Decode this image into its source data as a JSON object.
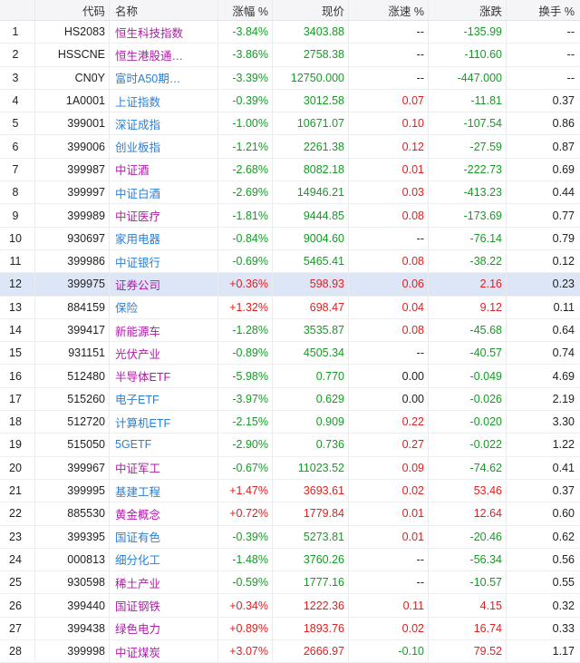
{
  "colors": {
    "up": "#e02020",
    "down": "#169b26",
    "name_blue": "#2a7fd4",
    "name_purple": "#b01aa8",
    "selected_row": "#dde6f7"
  },
  "headers": {
    "code": "代码",
    "name": "名称",
    "change_pct": "涨幅 %",
    "price": "现价",
    "speed": "涨速 %",
    "change": "涨跌",
    "turnover": "换手 %"
  },
  "rows": [
    {
      "idx": "1",
      "code": "HS2083",
      "name": "恒生科技指数",
      "name_color": "purple",
      "chg": "-3.84%",
      "chg_dir": "down",
      "price": "3403.88",
      "price_dir": "down",
      "speed": "--",
      "speed_dir": "none",
      "diff": "-135.99",
      "diff_dir": "down",
      "turnover": "--"
    },
    {
      "idx": "2",
      "code": "HSSCNE",
      "name": "恒生港股通…",
      "name_color": "purple",
      "chg": "-3.86%",
      "chg_dir": "down",
      "price": "2758.38",
      "price_dir": "down",
      "speed": "--",
      "speed_dir": "none",
      "diff": "-110.60",
      "diff_dir": "down",
      "turnover": "--"
    },
    {
      "idx": "3",
      "code": "CN0Y",
      "name": "富时A50期…",
      "name_color": "blue",
      "chg": "-3.39%",
      "chg_dir": "down",
      "price": "12750.000",
      "price_dir": "down",
      "speed": "--",
      "speed_dir": "none",
      "diff": "-447.000",
      "diff_dir": "down",
      "turnover": "--"
    },
    {
      "idx": "4",
      "code": "1A0001",
      "name": "上证指数",
      "name_color": "blue",
      "chg": "-0.39%",
      "chg_dir": "down",
      "price": "3012.58",
      "price_dir": "down",
      "speed": "0.07",
      "speed_dir": "up",
      "diff": "-11.81",
      "diff_dir": "down",
      "turnover": "0.37"
    },
    {
      "idx": "5",
      "code": "399001",
      "name": "深证成指",
      "name_color": "blue",
      "chg": "-1.00%",
      "chg_dir": "down",
      "price": "10671.07",
      "price_dir": "down",
      "speed": "0.10",
      "speed_dir": "up",
      "diff": "-107.54",
      "diff_dir": "down",
      "turnover": "0.86"
    },
    {
      "idx": "6",
      "code": "399006",
      "name": "创业板指",
      "name_color": "blue",
      "chg": "-1.21%",
      "chg_dir": "down",
      "price": "2261.38",
      "price_dir": "down",
      "speed": "0.12",
      "speed_dir": "up",
      "diff": "-27.59",
      "diff_dir": "down",
      "turnover": "0.87"
    },
    {
      "idx": "7",
      "code": "399987",
      "name": "中证酒",
      "name_color": "purple",
      "chg": "-2.68%",
      "chg_dir": "down",
      "price": "8082.18",
      "price_dir": "down",
      "speed": "0.01",
      "speed_dir": "up",
      "diff": "-222.73",
      "diff_dir": "down",
      "turnover": "0.69"
    },
    {
      "idx": "8",
      "code": "399997",
      "name": "中证白酒",
      "name_color": "blue",
      "chg": "-2.69%",
      "chg_dir": "down",
      "price": "14946.21",
      "price_dir": "down",
      "speed": "0.03",
      "speed_dir": "up",
      "diff": "-413.23",
      "diff_dir": "down",
      "turnover": "0.44"
    },
    {
      "idx": "9",
      "code": "399989",
      "name": "中证医疗",
      "name_color": "purple",
      "chg": "-1.81%",
      "chg_dir": "down",
      "price": "9444.85",
      "price_dir": "down",
      "speed": "0.08",
      "speed_dir": "up",
      "diff": "-173.69",
      "diff_dir": "down",
      "turnover": "0.77"
    },
    {
      "idx": "10",
      "code": "930697",
      "name": "家用电器",
      "name_color": "blue",
      "chg": "-0.84%",
      "chg_dir": "down",
      "price": "9004.60",
      "price_dir": "down",
      "speed": "--",
      "speed_dir": "none",
      "diff": "-76.14",
      "diff_dir": "down",
      "turnover": "0.79"
    },
    {
      "idx": "11",
      "code": "399986",
      "name": "中证银行",
      "name_color": "blue",
      "chg": "-0.69%",
      "chg_dir": "down",
      "price": "5465.41",
      "price_dir": "down",
      "speed": "0.08",
      "speed_dir": "up",
      "diff": "-38.22",
      "diff_dir": "down",
      "turnover": "0.12"
    },
    {
      "idx": "12",
      "code": "399975",
      "name": "证券公司",
      "name_color": "purple",
      "chg": "+0.36%",
      "chg_dir": "up",
      "price": "598.93",
      "price_dir": "up",
      "speed": "0.06",
      "speed_dir": "up",
      "diff": "2.16",
      "diff_dir": "up",
      "turnover": "0.23",
      "selected": true
    },
    {
      "idx": "13",
      "code": "884159",
      "name": "保险",
      "name_color": "blue",
      "chg": "+1.32%",
      "chg_dir": "up",
      "price": "698.47",
      "price_dir": "up",
      "speed": "0.04",
      "speed_dir": "up",
      "diff": "9.12",
      "diff_dir": "up",
      "turnover": "0.11"
    },
    {
      "idx": "14",
      "code": "399417",
      "name": "新能源车",
      "name_color": "purple",
      "chg": "-1.28%",
      "chg_dir": "down",
      "price": "3535.87",
      "price_dir": "down",
      "speed": "0.08",
      "speed_dir": "up",
      "diff": "-45.68",
      "diff_dir": "down",
      "turnover": "0.64"
    },
    {
      "idx": "15",
      "code": "931151",
      "name": "光伏产业",
      "name_color": "purple",
      "chg": "-0.89%",
      "chg_dir": "down",
      "price": "4505.34",
      "price_dir": "down",
      "speed": "--",
      "speed_dir": "none",
      "diff": "-40.57",
      "diff_dir": "down",
      "turnover": "0.74"
    },
    {
      "idx": "16",
      "code": "512480",
      "name": "半导体ETF",
      "name_color": "purple",
      "chg": "-5.98%",
      "chg_dir": "down",
      "price": "0.770",
      "price_dir": "down",
      "speed": "0.00",
      "speed_dir": "flat",
      "diff": "-0.049",
      "diff_dir": "down",
      "turnover": "4.69"
    },
    {
      "idx": "17",
      "code": "515260",
      "name": "电子ETF",
      "name_color": "blue",
      "chg": "-3.97%",
      "chg_dir": "down",
      "price": "0.629",
      "price_dir": "down",
      "speed": "0.00",
      "speed_dir": "flat",
      "diff": "-0.026",
      "diff_dir": "down",
      "turnover": "2.19"
    },
    {
      "idx": "18",
      "code": "512720",
      "name": "计算机ETF",
      "name_color": "blue",
      "chg": "-2.15%",
      "chg_dir": "down",
      "price": "0.909",
      "price_dir": "down",
      "speed": "0.22",
      "speed_dir": "up",
      "diff": "-0.020",
      "diff_dir": "down",
      "turnover": "3.30"
    },
    {
      "idx": "19",
      "code": "515050",
      "name": "5GETF",
      "name_color": "blue",
      "chg": "-2.90%",
      "chg_dir": "down",
      "price": "0.736",
      "price_dir": "down",
      "speed": "0.27",
      "speed_dir": "up",
      "diff": "-0.022",
      "diff_dir": "down",
      "turnover": "1.22"
    },
    {
      "idx": "20",
      "code": "399967",
      "name": "中证军工",
      "name_color": "purple",
      "chg": "-0.67%",
      "chg_dir": "down",
      "price": "11023.52",
      "price_dir": "down",
      "speed": "0.09",
      "speed_dir": "up",
      "diff": "-74.62",
      "diff_dir": "down",
      "turnover": "0.41"
    },
    {
      "idx": "21",
      "code": "399995",
      "name": "基建工程",
      "name_color": "blue",
      "chg": "+1.47%",
      "chg_dir": "up",
      "price": "3693.61",
      "price_dir": "up",
      "speed": "0.02",
      "speed_dir": "up",
      "diff": "53.46",
      "diff_dir": "up",
      "turnover": "0.37"
    },
    {
      "idx": "22",
      "code": "885530",
      "name": "黄金概念",
      "name_color": "purple",
      "chg": "+0.72%",
      "chg_dir": "up",
      "price": "1779.84",
      "price_dir": "up",
      "speed": "0.01",
      "speed_dir": "up",
      "diff": "12.64",
      "diff_dir": "up",
      "turnover": "0.60"
    },
    {
      "idx": "23",
      "code": "399395",
      "name": "国证有色",
      "name_color": "blue",
      "chg": "-0.39%",
      "chg_dir": "down",
      "price": "5273.81",
      "price_dir": "down",
      "speed": "0.01",
      "speed_dir": "up",
      "diff": "-20.46",
      "diff_dir": "down",
      "turnover": "0.62"
    },
    {
      "idx": "24",
      "code": "000813",
      "name": "细分化工",
      "name_color": "blue",
      "chg": "-1.48%",
      "chg_dir": "down",
      "price": "3760.26",
      "price_dir": "down",
      "speed": "--",
      "speed_dir": "none",
      "diff": "-56.34",
      "diff_dir": "down",
      "turnover": "0.56"
    },
    {
      "idx": "25",
      "code": "930598",
      "name": "稀土产业",
      "name_color": "purple",
      "chg": "-0.59%",
      "chg_dir": "down",
      "price": "1777.16",
      "price_dir": "down",
      "speed": "--",
      "speed_dir": "none",
      "diff": "-10.57",
      "diff_dir": "down",
      "turnover": "0.55"
    },
    {
      "idx": "26",
      "code": "399440",
      "name": "国证钢铁",
      "name_color": "purple",
      "chg": "+0.34%",
      "chg_dir": "up",
      "price": "1222.36",
      "price_dir": "up",
      "speed": "0.11",
      "speed_dir": "up",
      "diff": "4.15",
      "diff_dir": "up",
      "turnover": "0.32"
    },
    {
      "idx": "27",
      "code": "399438",
      "name": "绿色电力",
      "name_color": "purple",
      "chg": "+0.89%",
      "chg_dir": "up",
      "price": "1893.76",
      "price_dir": "up",
      "speed": "0.02",
      "speed_dir": "up",
      "diff": "16.74",
      "diff_dir": "up",
      "turnover": "0.33"
    },
    {
      "idx": "28",
      "code": "399998",
      "name": "中证煤炭",
      "name_color": "purple",
      "chg": "+3.07%",
      "chg_dir": "up",
      "price": "2666.97",
      "price_dir": "up",
      "speed": "-0.10",
      "speed_dir": "down",
      "diff": "79.52",
      "diff_dir": "up",
      "turnover": "1.17"
    }
  ]
}
